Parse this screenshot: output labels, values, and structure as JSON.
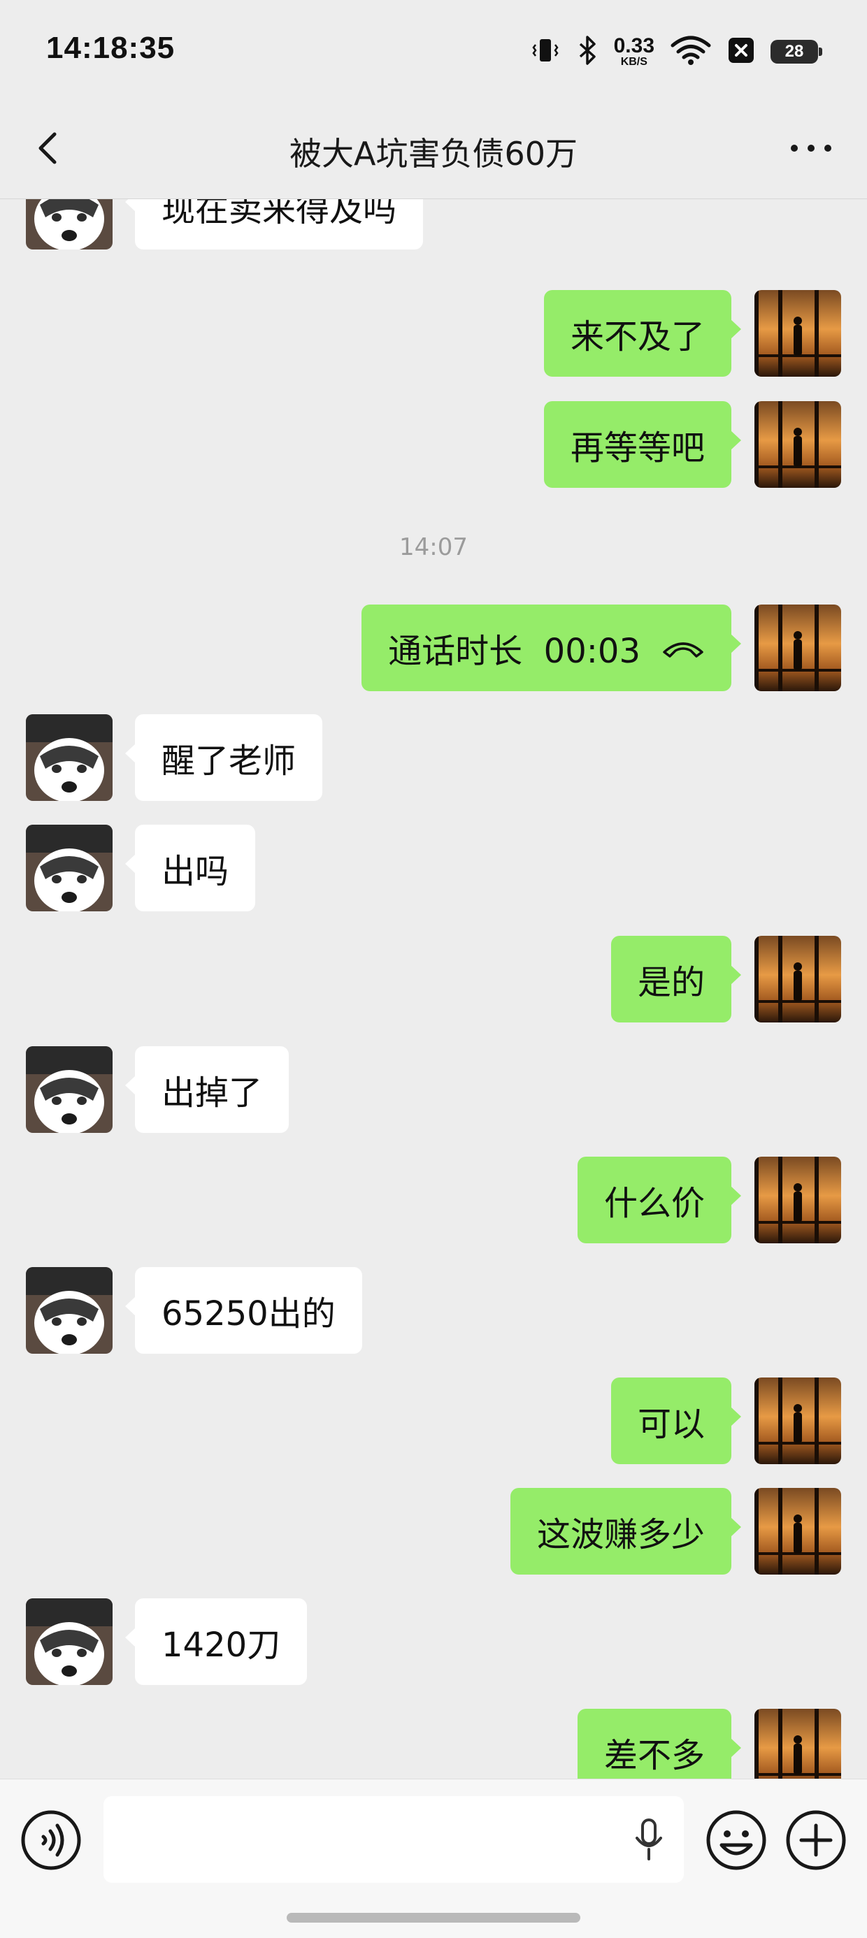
{
  "status_bar": {
    "time": "14:18:35",
    "net_speed_value": "0.33",
    "net_speed_unit": "KB/S",
    "battery_level": "28",
    "icons": [
      "vibrate-icon",
      "bluetooth-icon",
      "wifi-icon",
      "notification-x-icon",
      "battery-icon"
    ]
  },
  "header": {
    "title": "被大A坑害负债60万",
    "back_icon": "chevron-left-icon",
    "more_icon": "more-dots-icon"
  },
  "messages": [
    {
      "side": "left",
      "text": "现在卖来得及吗"
    },
    {
      "side": "right",
      "text": "来不及了"
    },
    {
      "side": "right",
      "text": "再等等吧"
    },
    {
      "type": "timestamp",
      "text": "14:07"
    },
    {
      "side": "right",
      "type": "call",
      "text": "通话时长  00:03"
    },
    {
      "side": "left",
      "text": "醒了老师"
    },
    {
      "side": "left",
      "text": "出吗"
    },
    {
      "side": "right",
      "text": "是的"
    },
    {
      "side": "left",
      "text": "出掉了"
    },
    {
      "side": "right",
      "text": "什么价"
    },
    {
      "side": "left",
      "text": "65250出的"
    },
    {
      "side": "right",
      "text": "可以"
    },
    {
      "side": "right",
      "text": "这波赚多少"
    },
    {
      "side": "left",
      "text": "1420刀"
    },
    {
      "side": "right",
      "text": "差不多"
    }
  ],
  "input_bar": {
    "voice_icon": "voice-input-icon",
    "mic_icon": "microphone-icon",
    "emoji_icon": "emoji-icon",
    "plus_icon": "plus-icon",
    "input_value": ""
  },
  "colors": {
    "background": "#ededed",
    "self_bubble": "#95ec69",
    "other_bubble": "#ffffff"
  }
}
